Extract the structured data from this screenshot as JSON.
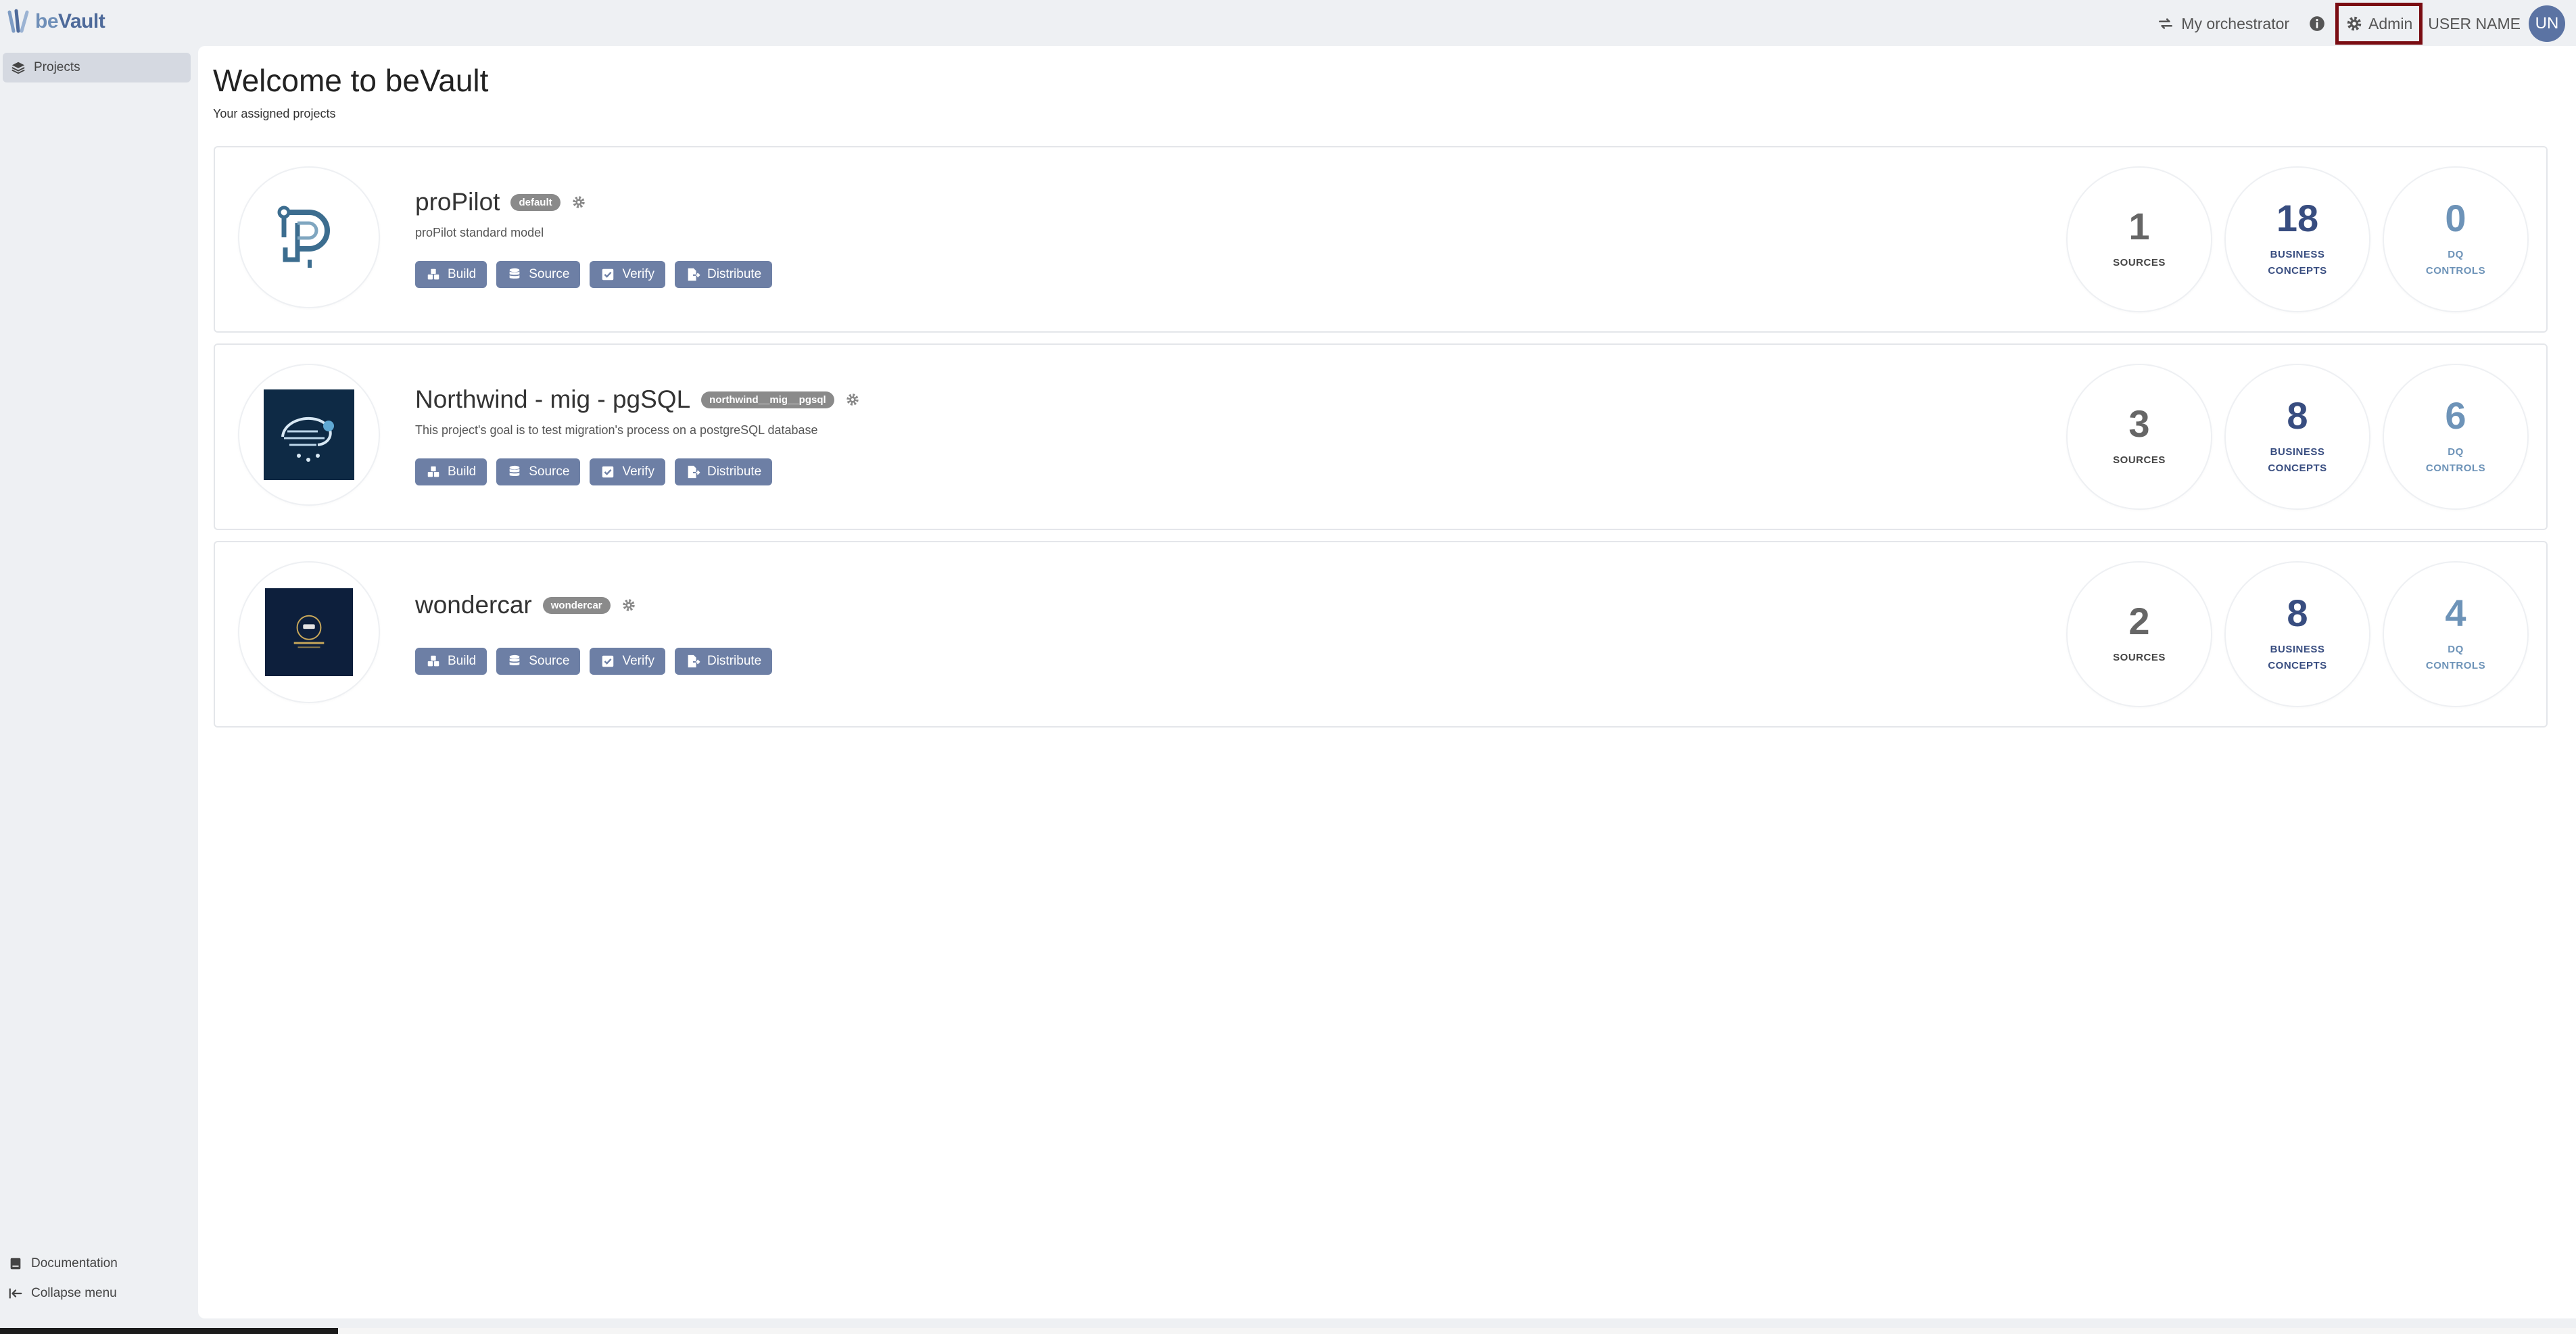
{
  "app": {
    "name": "beVault",
    "name_be": "be",
    "name_rest": "Vault"
  },
  "header": {
    "orchestrator_label": "My orchestrator",
    "admin_label": "Admin",
    "user_name": "USER NAME",
    "avatar_initials": "UN",
    "icons": [
      "sync-icon",
      "info-icon",
      "gear-icon"
    ]
  },
  "sidebar": {
    "items": [
      {
        "label": "Projects",
        "icon": "layers-icon"
      }
    ],
    "bottom": [
      {
        "label": "Documentation",
        "icon": "book-icon"
      },
      {
        "label": "Collapse menu",
        "icon": "collapse-icon"
      }
    ]
  },
  "main": {
    "title": "Welcome to beVault",
    "subtitle": "Your assigned projects",
    "buttons": [
      "Build",
      "Source",
      "Verify",
      "Distribute"
    ],
    "projects": [
      {
        "name": "proPilot",
        "badge": "default",
        "description": "proPilot standard model",
        "stats": {
          "sources": "1",
          "business_concepts": "18",
          "dq_controls": "0"
        }
      },
      {
        "name": "Northwind - mig - pgSQL",
        "badge": "northwind__mig__pgsql",
        "description": "This project's goal is to test migration's process on a postgreSQL database",
        "stats": {
          "sources": "3",
          "business_concepts": "8",
          "dq_controls": "6"
        }
      },
      {
        "name": "wondercar",
        "badge": "wondercar",
        "description": "",
        "stats": {
          "sources": "2",
          "business_concepts": "8",
          "dq_controls": "4"
        }
      }
    ],
    "stat_labels": {
      "sources": "SOURCES",
      "bc_line1": "BUSINESS",
      "bc_line2": "CONCEPTS",
      "dq_line1": "DQ",
      "dq_line2": "CONTROLS"
    }
  },
  "colors": {
    "accent": "#6d7fa5",
    "brand": "#4e6a9a",
    "highlight_border": "#7a0c12"
  }
}
